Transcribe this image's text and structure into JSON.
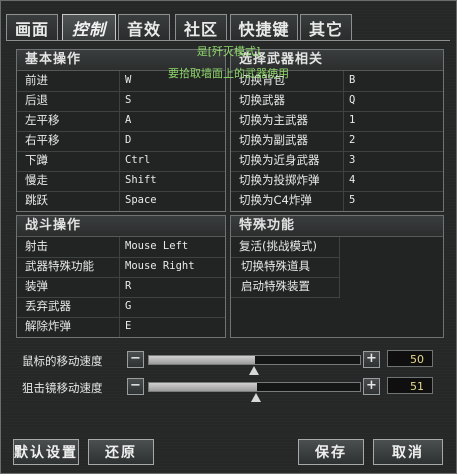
{
  "tabs": [
    {
      "label": "画面"
    },
    {
      "label": "控制"
    },
    {
      "label": "音效"
    },
    {
      "label": "社区"
    },
    {
      "label": "快捷键"
    },
    {
      "label": "其它"
    }
  ],
  "notice": {
    "line1": "是[歼灭模式]",
    "line2": "要拾取墙面上的武器使用"
  },
  "basic": {
    "title": "基本操作",
    "rows": [
      {
        "action": "前进",
        "key": "W"
      },
      {
        "action": "后退",
        "key": "S"
      },
      {
        "action": "左平移",
        "key": "A"
      },
      {
        "action": "右平移",
        "key": "D"
      },
      {
        "action": "下蹲",
        "key": "Ctrl"
      },
      {
        "action": "慢走",
        "key": "Shift"
      },
      {
        "action": "跳跃",
        "key": "Space"
      }
    ]
  },
  "weapon_switch": {
    "title": "选择武器相关",
    "rows": [
      {
        "action": "切换背包",
        "key": "B"
      },
      {
        "action": "切换武器",
        "key": "Q"
      },
      {
        "action": "切换为主武器",
        "key": "1"
      },
      {
        "action": "切换为副武器",
        "key": "2"
      },
      {
        "action": "切换为近身武器",
        "key": "3"
      },
      {
        "action": "切换为投掷炸弹",
        "key": "4"
      },
      {
        "action": "切换为C4炸弹",
        "key": "5"
      }
    ]
  },
  "combat": {
    "title": "战斗操作",
    "rows": [
      {
        "action": "射击",
        "key": "Mouse Left"
      },
      {
        "action": "武器特殊功能",
        "key": "Mouse Right"
      },
      {
        "action": "装弹",
        "key": "R"
      },
      {
        "action": "丢弃武器",
        "key": "G"
      },
      {
        "action": "解除炸弹",
        "key": "E"
      }
    ]
  },
  "special": {
    "title": "特殊功能",
    "items": [
      "复活(挑战模式)",
      "切换特殊道具",
      "启动特殊装置"
    ]
  },
  "sliders": [
    {
      "label": "鼠标的移动速度",
      "value": "50",
      "fraction": 0.5
    },
    {
      "label": "狙击镜移动速度",
      "value": "51",
      "fraction": 0.51
    }
  ],
  "buttons": {
    "defaults": "默认设置",
    "restore": "还原",
    "save": "保存",
    "cancel": "取消"
  }
}
